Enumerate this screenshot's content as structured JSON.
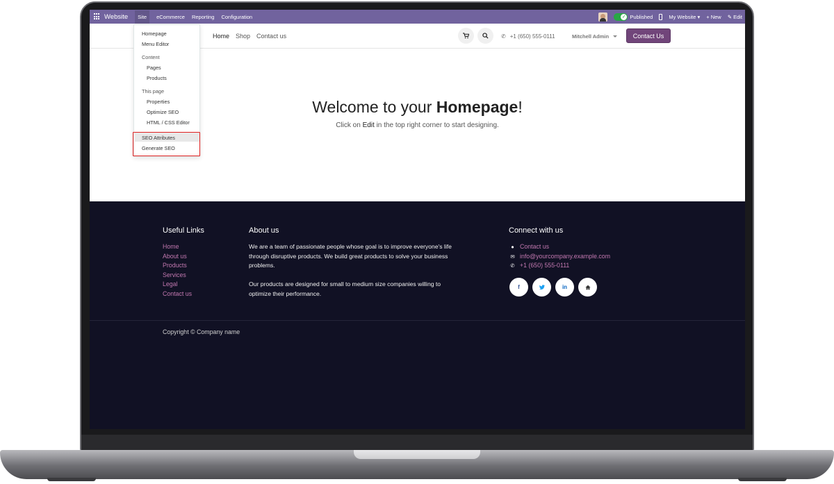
{
  "topbar": {
    "brand": "Website",
    "menu": [
      "Site",
      "eCommerce",
      "Reporting",
      "Configuration"
    ],
    "published_label": "Published",
    "website_label": "My Website ▾",
    "new_label": "+ New",
    "edit_label": "✎ Edit",
    "bar_color": "#71639e"
  },
  "site_header": {
    "nav": [
      "Home",
      "Shop",
      "Contact us"
    ],
    "phone": "+1 (650) 555-0111",
    "user": "Mitchell Admin",
    "cta": "Contact Us",
    "cta_color": "#71457a"
  },
  "dropdown": {
    "homepage": "Homepage",
    "menu_editor": "Menu Editor",
    "content_head": "Content",
    "pages": "Pages",
    "products": "Products",
    "this_page_head": "This page",
    "properties": "Properties",
    "optimize_seo": "Optimize SEO",
    "html_css": "HTML / CSS Editor",
    "seo_attributes": "SEO Attributes",
    "generate_seo": "Generate SEO"
  },
  "hero": {
    "title_prefix": "Welcome to your ",
    "title_bold": "Homepage",
    "title_suffix": "!",
    "sub_prefix": "Click on ",
    "sub_bold": "Edit",
    "sub_suffix": " in the top right corner to start designing."
  },
  "footer": {
    "useful_links_title": "Useful Links",
    "links": [
      "Home",
      "About us",
      "Products",
      "Services",
      "Legal",
      "Contact us"
    ],
    "about_title": "About us",
    "about_p1": "We are a team of passionate people whose goal is to improve everyone's life through disruptive products. We build great products to solve your business problems.",
    "about_p2": "Our products are designed for small to medium size companies willing to optimize their performance.",
    "connect_title": "Connect with us",
    "contact_us": "Contact us",
    "email": "info@yourcompany.example.com",
    "phone": "+1 (650) 555-0111",
    "socials": [
      "f",
      "t",
      "in",
      "home"
    ],
    "copyright": "Copyright © Company name",
    "bg_color": "#111124",
    "link_color": "#c278b0"
  }
}
